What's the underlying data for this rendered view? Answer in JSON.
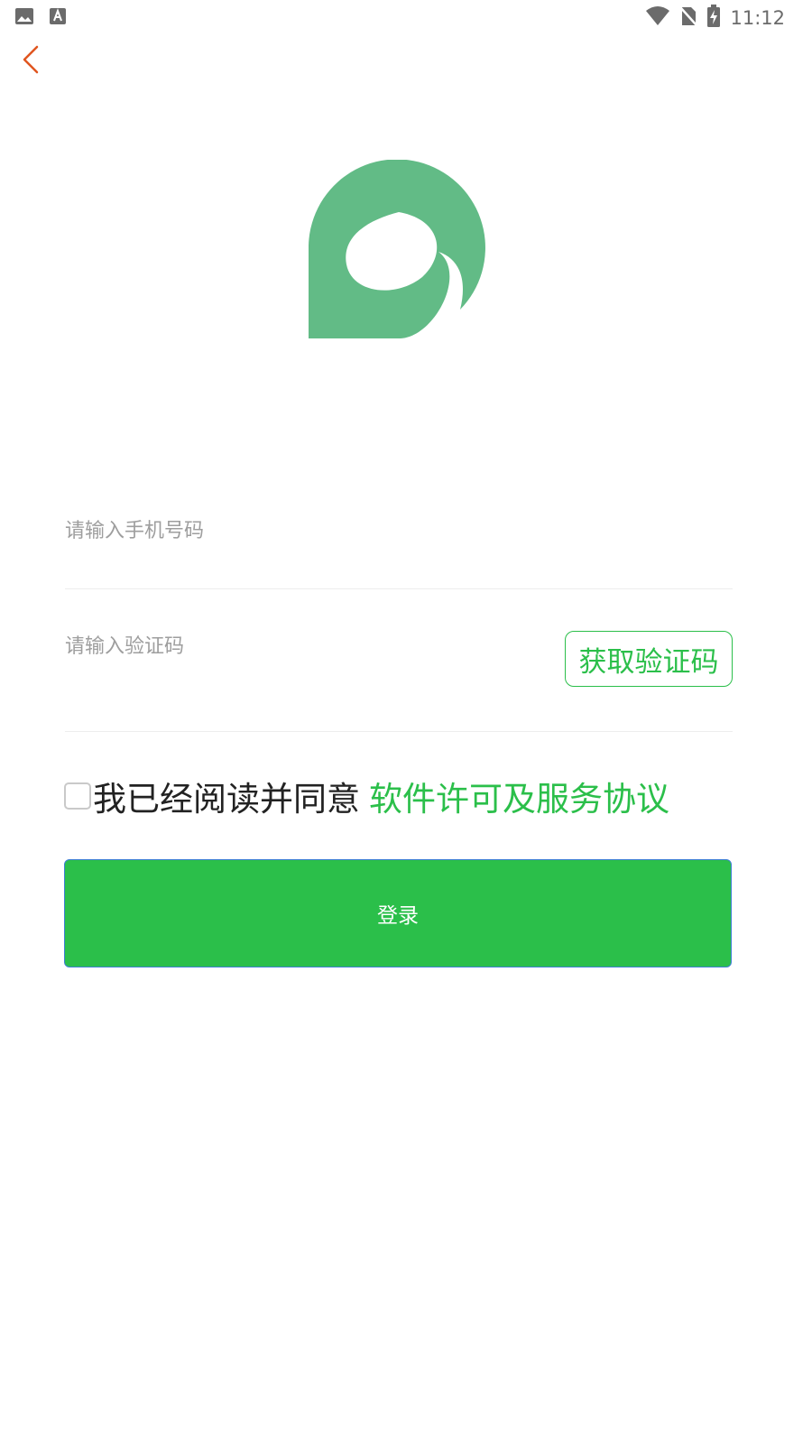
{
  "status_bar": {
    "time": "11:12",
    "left_icons": [
      "image-icon",
      "text-icon"
    ],
    "right_icons": [
      "wifi-icon",
      "no-sim-icon",
      "battery-charging-icon"
    ]
  },
  "nav": {
    "back_icon": "chevron-left-icon"
  },
  "form": {
    "phone": {
      "value": "",
      "placeholder": "请输入手机号码"
    },
    "code": {
      "value": "",
      "placeholder": "请输入验证码"
    },
    "get_code_label": "获取验证码"
  },
  "agreement": {
    "checked": false,
    "text": "我已经阅读并同意",
    "link": "软件许可及服务协议"
  },
  "login": {
    "label": "登录"
  },
  "colors": {
    "accent": "#2bbf4a",
    "logo": "#62bb86",
    "back": "#e0551f",
    "login_border": "#3f7fd4"
  }
}
